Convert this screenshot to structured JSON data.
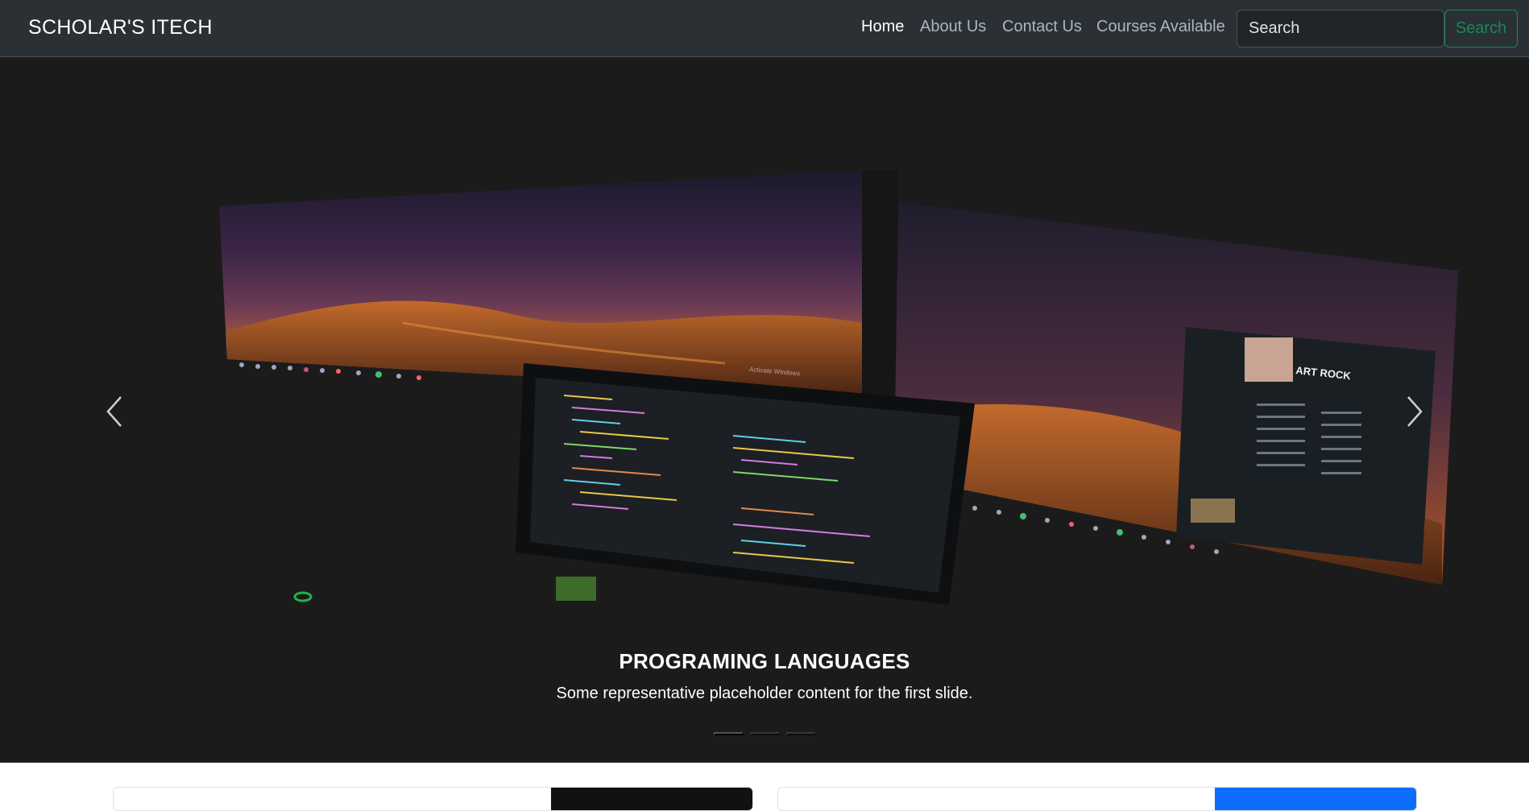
{
  "navbar": {
    "brand": "SCHOLAR'S ITECH",
    "links": [
      {
        "label": "Home",
        "active": true
      },
      {
        "label": "About Us",
        "active": false
      },
      {
        "label": "Contact Us",
        "active": false
      },
      {
        "label": "Courses Available",
        "active": false
      }
    ],
    "search": {
      "placeholder": "Search",
      "button_label": "Search"
    }
  },
  "carousel": {
    "slide": {
      "title": "PROGRAMING LANGUAGES",
      "text": "Some representative placeholder content for the first slide.",
      "image_ui_text": [
        "ART ROCK",
        "Activate Windows"
      ]
    },
    "indicators": 3,
    "active_indicator": 0,
    "prev_icon": "chevron-left-icon",
    "next_icon": "chevron-right-icon"
  },
  "colors": {
    "navbar_bg": "#2b3035",
    "success": "#198754",
    "carousel_bg": "#1b1b1b",
    "card_dark": "#111111",
    "card_blue": "#0d6efd"
  }
}
